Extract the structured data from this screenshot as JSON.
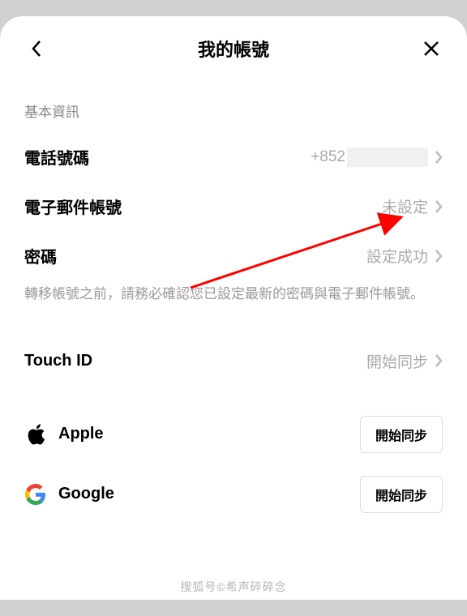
{
  "header": {
    "title": "我的帳號"
  },
  "section": {
    "basic_info": "基本資訊"
  },
  "rows": {
    "phone": {
      "label": "電話號碼",
      "prefix": "+852"
    },
    "email": {
      "label": "電子郵件帳號",
      "value": "未設定"
    },
    "password": {
      "label": "密碼",
      "value": "設定成功"
    },
    "note": "轉移帳號之前，請務必確認您已設定最新的密碼與電子郵件帳號。",
    "touchid": {
      "label": "Touch ID",
      "value": "開始同步"
    }
  },
  "sync": {
    "apple": {
      "label": "Apple",
      "button": "開始同步"
    },
    "google": {
      "label": "Google",
      "button": "開始同步"
    }
  },
  "watermark": {
    "site": "搜狐号",
    "author": "希声碎碎念"
  }
}
